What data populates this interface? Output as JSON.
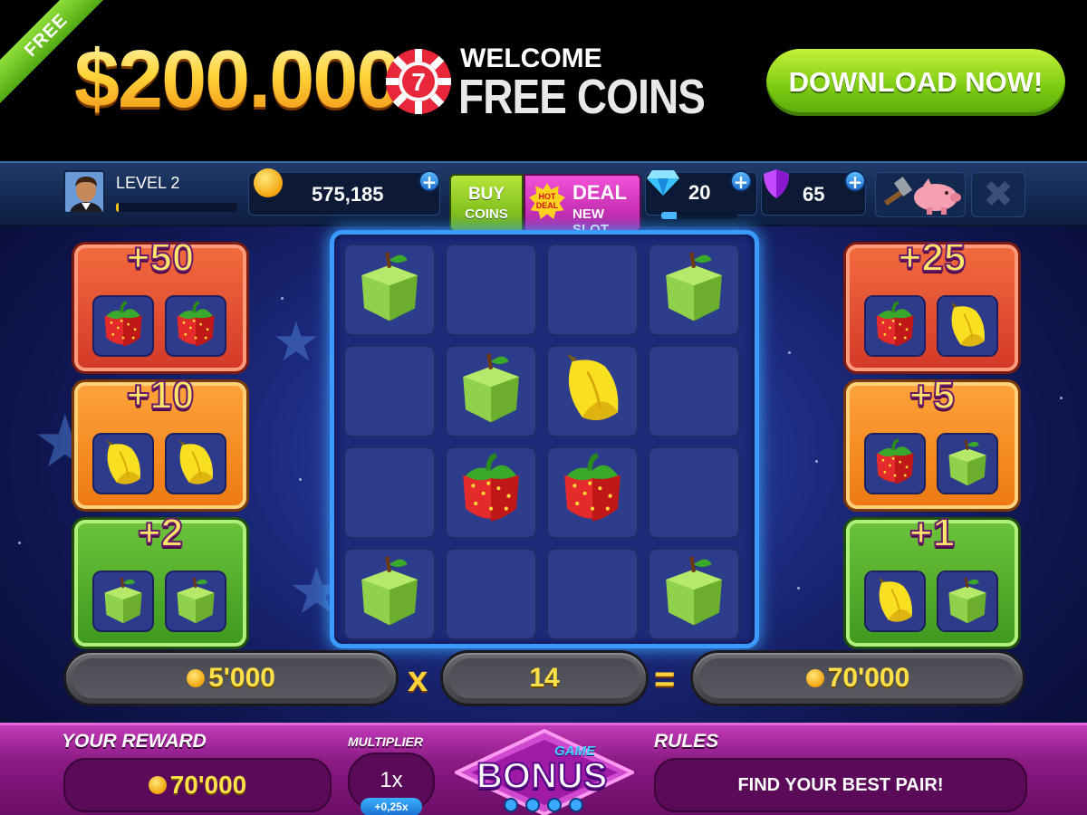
{
  "banner": {
    "ribbon": "FREE",
    "amount": "$200.000",
    "chip_number": "7",
    "welcome": "WELCOME",
    "free_coins": "FREE COINS",
    "download_label": "DOWNLOAD NOW!"
  },
  "status": {
    "level_label": "LEVEL 2",
    "level_progress": 0.02,
    "coins": "575,185",
    "buy_line1": "BUY",
    "buy_line2": "COINS",
    "hot_badge": "HOT DEAL",
    "deal_title": "DEAL",
    "deal_sub": "NEW SLOT",
    "gems": "20",
    "gem_progress": 0.2,
    "shields": "65",
    "plus": "+"
  },
  "left_pays": [
    {
      "label": "+50",
      "color": "red",
      "fruits": [
        "strawberry",
        "strawberry"
      ]
    },
    {
      "label": "+10",
      "color": "orange",
      "fruits": [
        "banana",
        "banana"
      ]
    },
    {
      "label": "+2",
      "color": "green",
      "fruits": [
        "apple",
        "apple"
      ]
    }
  ],
  "right_pays": [
    {
      "label": "+25",
      "color": "red",
      "fruits": [
        "strawberry",
        "banana"
      ]
    },
    {
      "label": "+5",
      "color": "orange",
      "fruits": [
        "strawberry",
        "apple"
      ]
    },
    {
      "label": "+1",
      "color": "green",
      "fruits": [
        "banana",
        "apple"
      ]
    }
  ],
  "grid": [
    [
      "apple",
      "",
      "",
      "apple"
    ],
    [
      "",
      "apple",
      "banana",
      ""
    ],
    [
      "",
      "strawberry",
      "strawberry",
      ""
    ],
    [
      "apple",
      "",
      "",
      "apple"
    ]
  ],
  "formula": {
    "bet": "5'000",
    "times": "x",
    "multiplier": "14",
    "equals": "=",
    "result": "70'000"
  },
  "bottom": {
    "reward_label": "YOUR REWARD",
    "reward_value": "70'000",
    "multiplier_label": "MULTIPLIER",
    "multiplier_value": "1x",
    "multiplier_increment": "+0,25x",
    "bonus_small": "GAME",
    "bonus_big": "BONUS",
    "rules_label": "RULES",
    "rules_text": "FIND YOUR BEST PAIR!"
  },
  "colors": {
    "grid_border": "#3a9aff",
    "download_green": "#7fcc12",
    "bottom_magenta": "#8a1a84"
  }
}
